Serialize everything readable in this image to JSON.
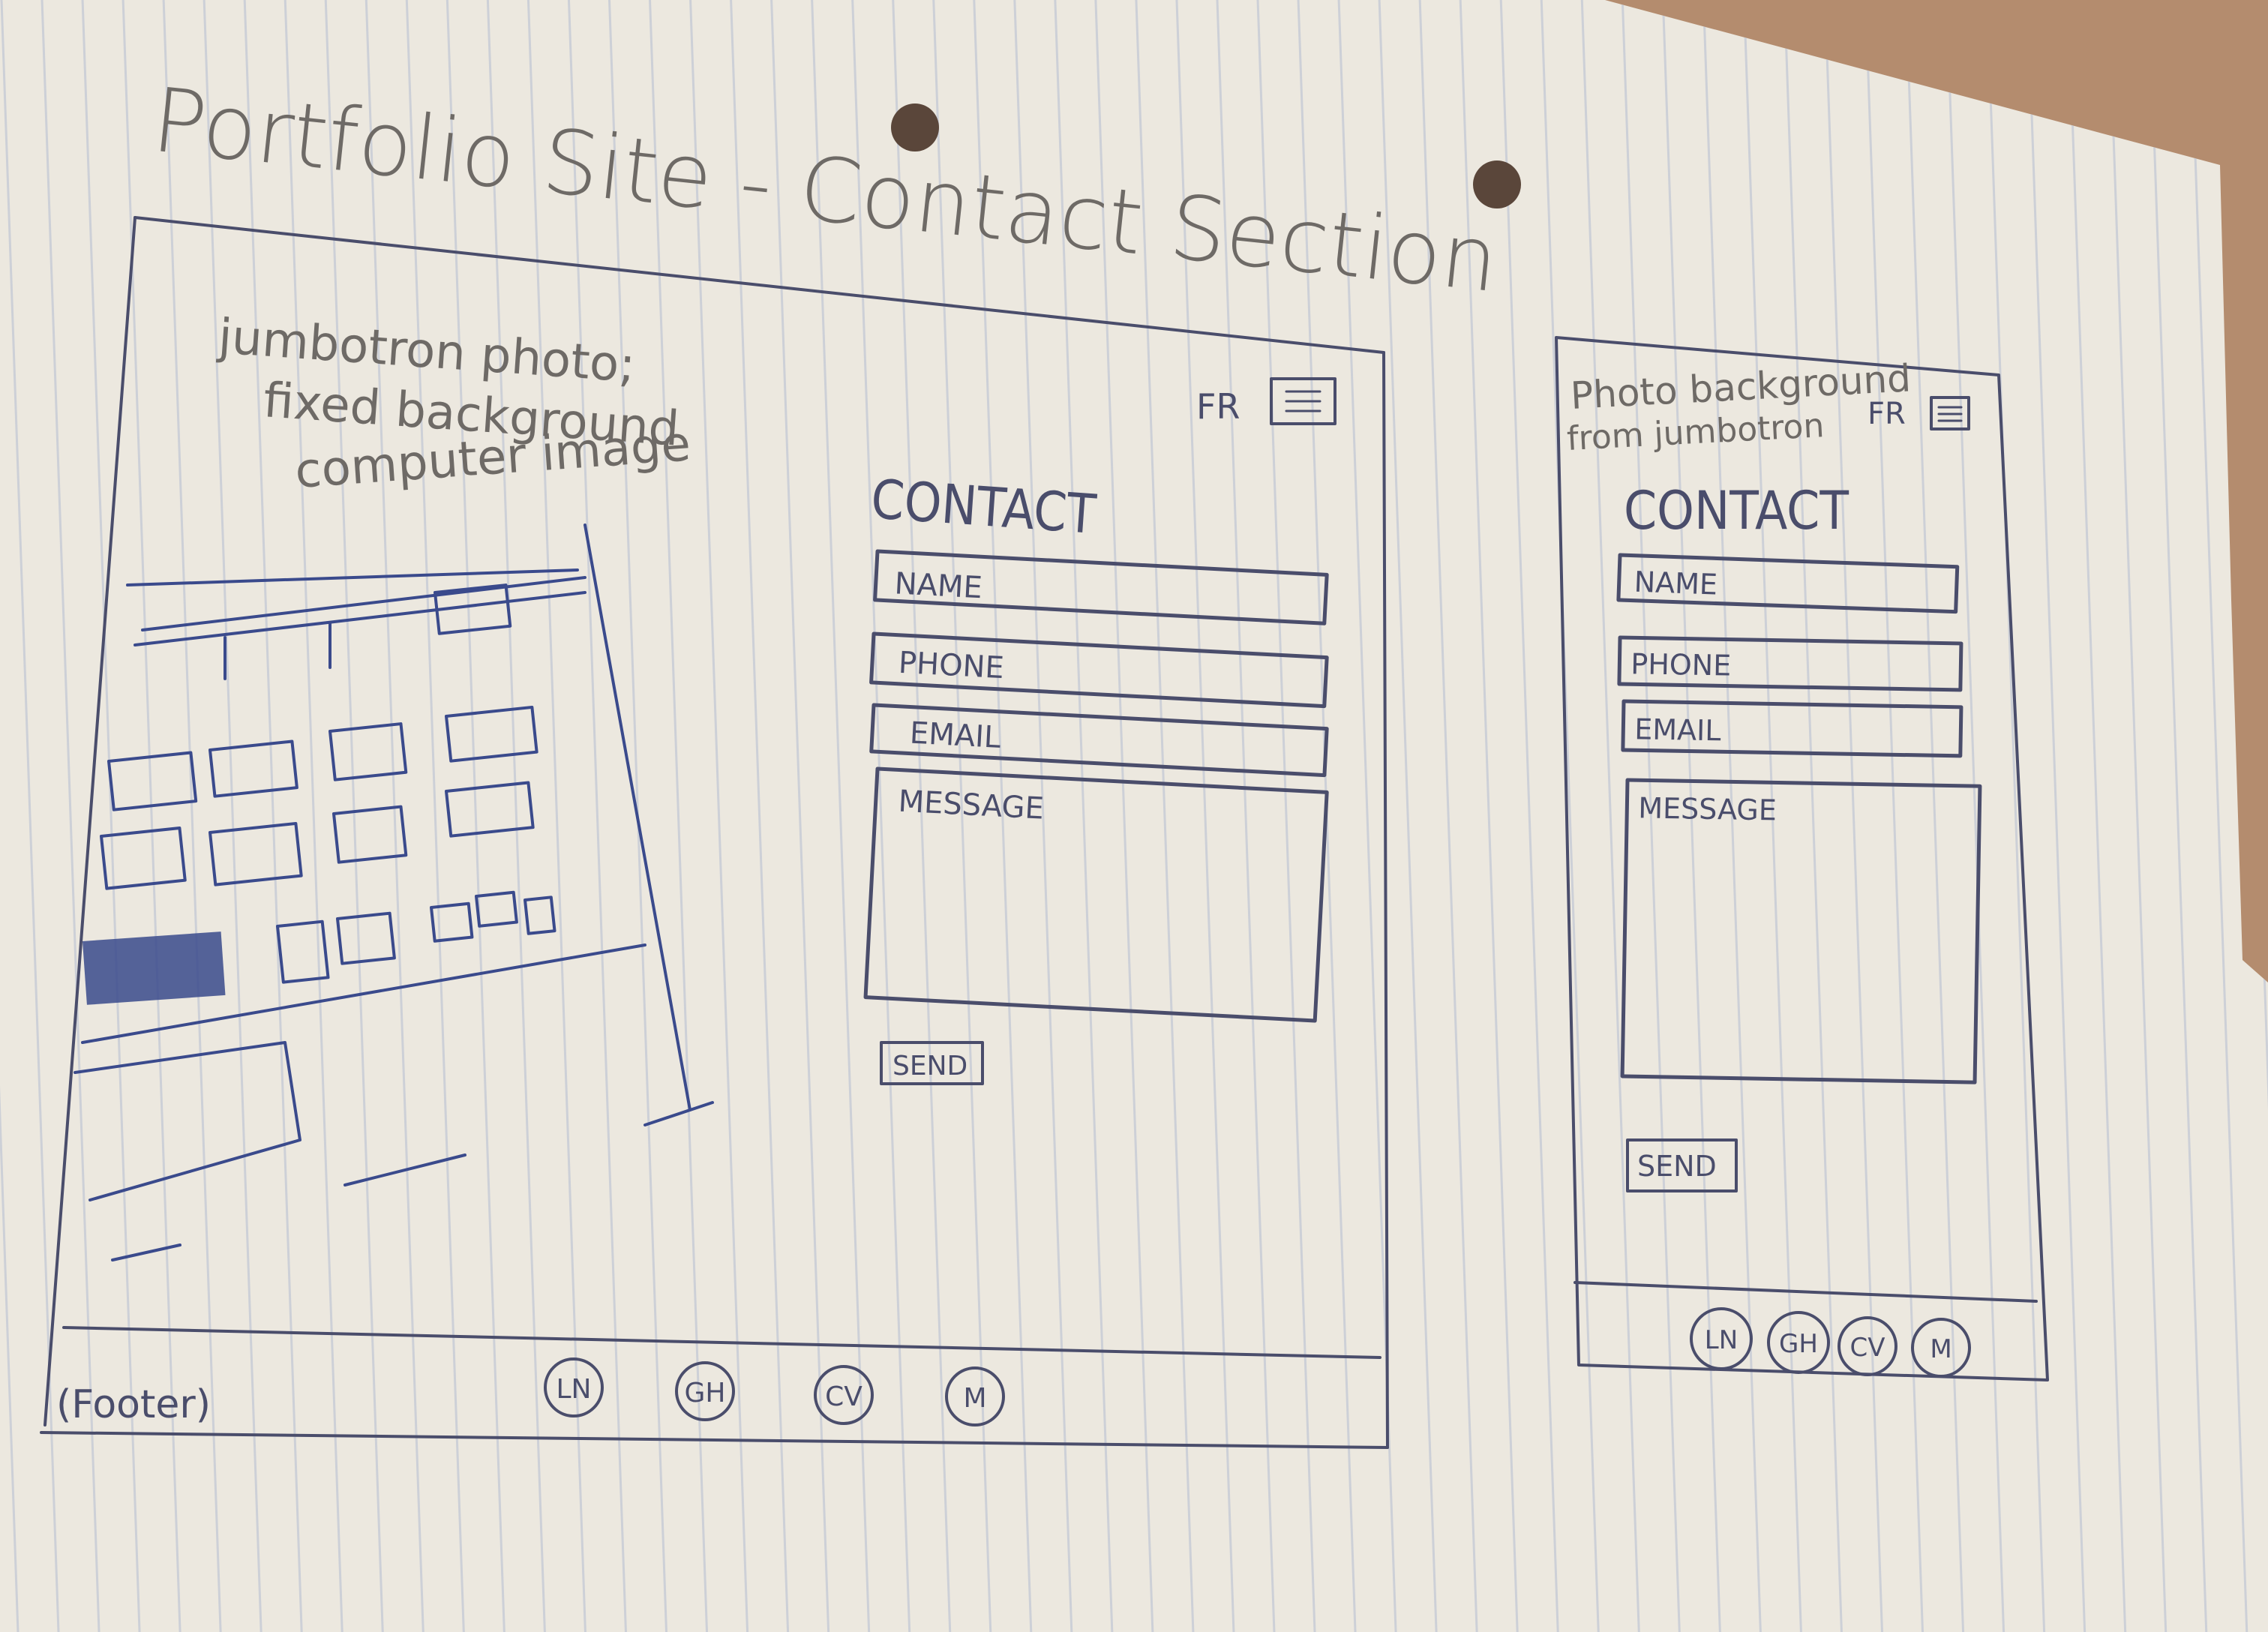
{
  "sheet": {
    "title": "Portfolio Site - Contact Section",
    "colors": {
      "paper": "#ece8df",
      "ink": "#4a4d6b",
      "pencil": "#6e6a66",
      "blue_ink": "#3a4a8c",
      "table": "#b48c6e"
    }
  },
  "desktop": {
    "jumbotron_note": [
      "jumbotron photo;",
      "fixed background",
      "computer image"
    ],
    "language_toggle": "FR",
    "menu_icon": "hamburger-icon",
    "contact_heading": "CONTACT",
    "fields": {
      "name": "NAME",
      "phone": "PHONE",
      "email": "EMAIL",
      "message": "MESSAGE"
    },
    "send_label": "SEND",
    "footer_label": "(Footer)",
    "social": [
      "LN",
      "GH",
      "CV",
      "M"
    ]
  },
  "mobile": {
    "background_note": [
      "Photo background",
      "from jumbotron"
    ],
    "language_toggle": "FR",
    "menu_icon": "hamburger-icon",
    "contact_heading": "CONTACT",
    "fields": {
      "name": "NAME",
      "phone": "PHONE",
      "email": "EMAIL",
      "message": "MESSAGE"
    },
    "send_label": "SEND",
    "social": [
      "LN",
      "GH",
      "CV",
      "M"
    ]
  }
}
